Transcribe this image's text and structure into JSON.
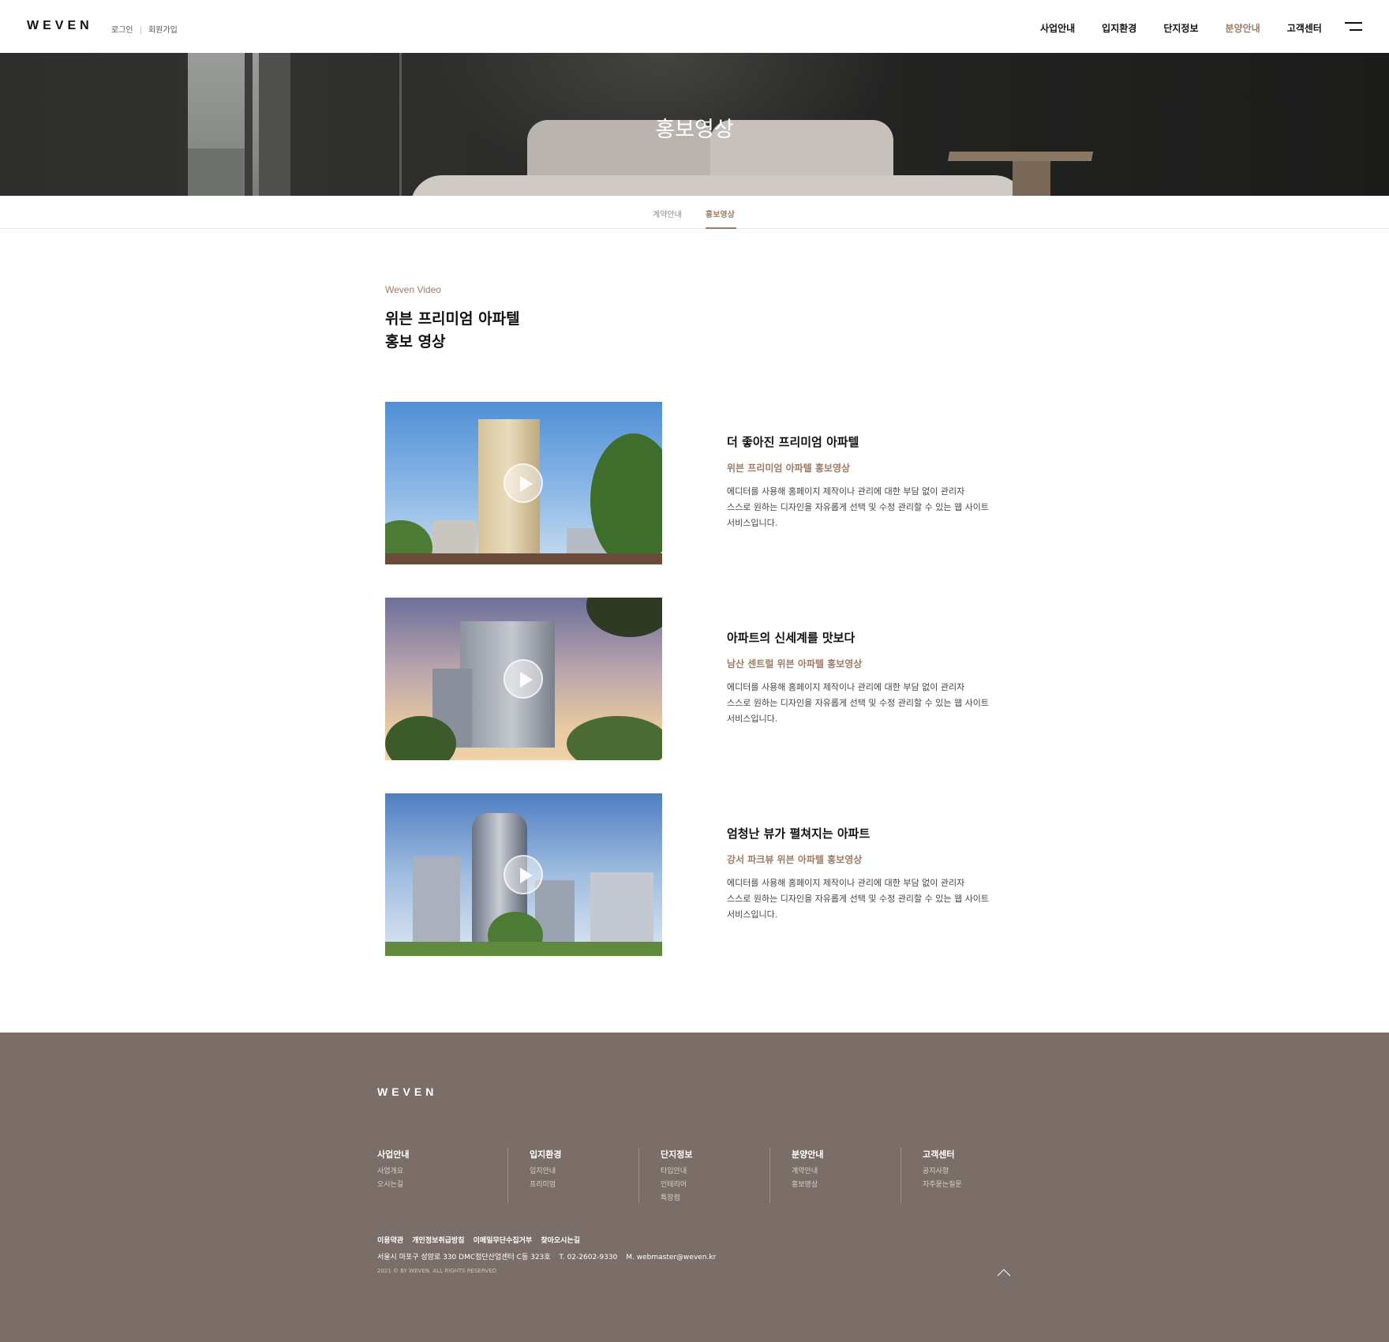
{
  "header": {
    "logo": "WEVEN",
    "login": "로그인",
    "signup": "회원가입",
    "nav": [
      "사업안내",
      "입지환경",
      "단지정보",
      "분양안내",
      "고객센터"
    ],
    "active_nav": "분양안내"
  },
  "hero": {
    "title": "홍보영상"
  },
  "subnav": {
    "tabs": [
      "계약안내",
      "홍보영상"
    ],
    "active": "홍보영상"
  },
  "section": {
    "eyebrow": "Weven Video",
    "title_line1": "위븐 프리미엄 아파텔",
    "title_line2": "홍보 영상"
  },
  "videos": [
    {
      "title": "더 좋아진 프리미엄 아파텔",
      "subtitle": "위븐 프리미엄 아파텔 홍보영상",
      "desc": "에디터를 사용해 홈페이지 제작이나 관리에 대한 부담 없이 관리자\n스스로 원하는 디자인을 자유롭게 선택 및 수정 관리할 수 있는 웹 사이트\n서비스입니다."
    },
    {
      "title": "아파트의 신세계를 맛보다",
      "subtitle": "남산 센트럴 위븐 아파텔 홍보영상",
      "desc": "에디터를 사용해 홈페이지 제작이나 관리에 대한 부담 없이 관리자\n스스로 원하는 디자인을 자유롭게 선택 및 수정 관리할 수 있는 웹 사이트\n서비스입니다."
    },
    {
      "title": "엄청난 뷰가 펼쳐지는 아파트",
      "subtitle": "강서 파크뷰 위븐 아파텔 홍보영상",
      "desc": "에디터를 사용해 홈페이지 제작이나 관리에 대한 부담 없이 관리자\n스스로 원하는 디자인을 자유롭게 선택 및 수정 관리할 수 있는 웹 사이트\n서비스입니다."
    }
  ],
  "footer": {
    "logo": "WEVEN",
    "columns": [
      {
        "title": "사업안내",
        "items": [
          "사업개요",
          "오시는길"
        ]
      },
      {
        "title": "입지환경",
        "items": [
          "입지안내",
          "프리미엄"
        ]
      },
      {
        "title": "단지정보",
        "items": [
          "타입안내",
          "인테리어",
          "특장점"
        ]
      },
      {
        "title": "분양안내",
        "items": [
          "계약안내",
          "홍보영상"
        ]
      },
      {
        "title": "고객센터",
        "items": [
          "공지사항",
          "자주묻는질문"
        ]
      }
    ],
    "links": [
      "이용약관",
      "개인정보취급방침",
      "이메일무단수집거부",
      "찾아오시는길"
    ],
    "address": "서울시 마포구 성암로 330 DMC첨단산업센터 C동 323호",
    "tel": "T. 02-2602-9330",
    "email": "M. webmaster@weven.kr",
    "copyright": "2021 © BY WEVEN. ALL RIGHTS RESERVED"
  },
  "colors": {
    "accent": "#9d7b66",
    "footer_bg": "#7b6e68"
  }
}
